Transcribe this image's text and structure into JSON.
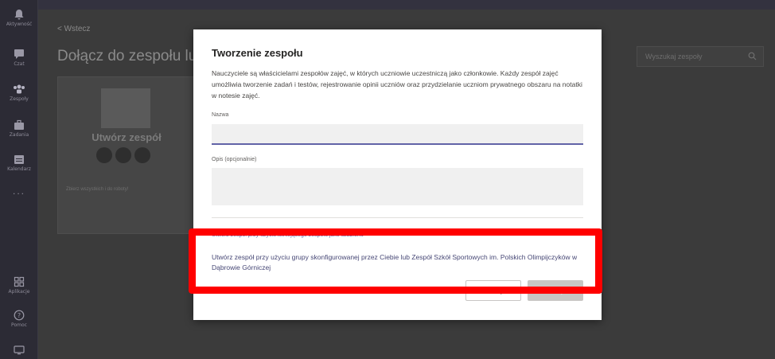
{
  "rail": {
    "items": [
      {
        "icon": "bell-icon",
        "label": "Aktywność"
      },
      {
        "icon": "chat-icon",
        "label": "Czat"
      },
      {
        "icon": "teams-icon",
        "label": "Zespoły"
      },
      {
        "icon": "briefcase-icon",
        "label": "Zadania"
      },
      {
        "icon": "calendar-icon",
        "label": "Kalendarz"
      },
      {
        "icon": "more-icon",
        "label": "..."
      }
    ],
    "bottom": [
      {
        "icon": "apps-icon",
        "label": "Aplikacje"
      },
      {
        "icon": "help-icon",
        "label": "Pomoc"
      },
      {
        "icon": "device-icon",
        "label": ""
      }
    ]
  },
  "main": {
    "back": "< Wstecz",
    "title": "Dołącz do zespołu lub utwórz zespół",
    "search_placeholder": "Wyszukaj zespoły",
    "card": {
      "title": "Utwórz zespół",
      "subtitle": "Zbierz wszystkich i do roboty!"
    }
  },
  "dialog": {
    "title": "Tworzenie zespołu",
    "description": "Nauczyciele są właścicielami zespołów zajęć, w których uczniowie uczestniczą jako członkowie. Każdy zespół zajęć umożliwia tworzenie zadań i testów, rejestrowanie opinii uczniów oraz przydzielanie uczniom prywatnego obszaru na notatki w notesie zajęć.",
    "name_label": "Nazwa",
    "name_value": "",
    "desc_label": "Opis (opcjonalnie)",
    "desc_value": "",
    "existing_team_link": "Utwórz zespół przy użyciu istniejącego zespołu jako szablonu",
    "group_link": "Utwórz zespół przy użyciu grupy skonfigurowanej przez Ciebie lub Zespół Szkół Sportowych im. Polskich Olimpijczyków w Dąbrowie Górniczej",
    "cancel_label": "Anuluj",
    "next_label": "Dalej"
  },
  "colors": {
    "accent": "#6264a7",
    "highlight": "#ff0000",
    "overlay": "#3b3b3b"
  }
}
